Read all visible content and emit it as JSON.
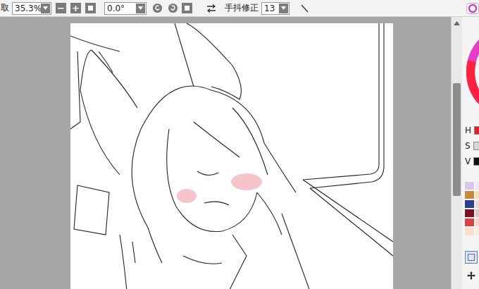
{
  "toolbar": {
    "zoom_label": "取",
    "zoom_value": "35.3%",
    "zoom_out": "−",
    "zoom_in": "+",
    "rotation_value": "0.0°",
    "stabilizer_label": "手抖修正",
    "stabilizer_value": "13"
  },
  "hsv": [
    {
      "label": "H",
      "color": "#e02020"
    },
    {
      "label": "S",
      "color": "#d8d8d8"
    },
    {
      "label": "V",
      "color": "#101010"
    }
  ],
  "swatches": [
    {
      "color": "#d6c8e6"
    },
    {
      "color": "#efe4f2"
    },
    {
      "color": "#c98a3a"
    },
    {
      "color": "#f3dfb4"
    },
    {
      "color": "#2b3f8c"
    },
    {
      "color": "#eed8d6"
    },
    {
      "color": "#7a1222"
    },
    {
      "color": "#e6c3c3"
    },
    {
      "color": "#d84444"
    },
    {
      "color": "#f3d4c6"
    },
    {
      "color": "#f6e1cf"
    },
    {
      "color": "#f7ece0"
    }
  ],
  "tools": [
    {
      "name": "select",
      "selected": true
    },
    {
      "name": "move",
      "selected": false
    }
  ]
}
